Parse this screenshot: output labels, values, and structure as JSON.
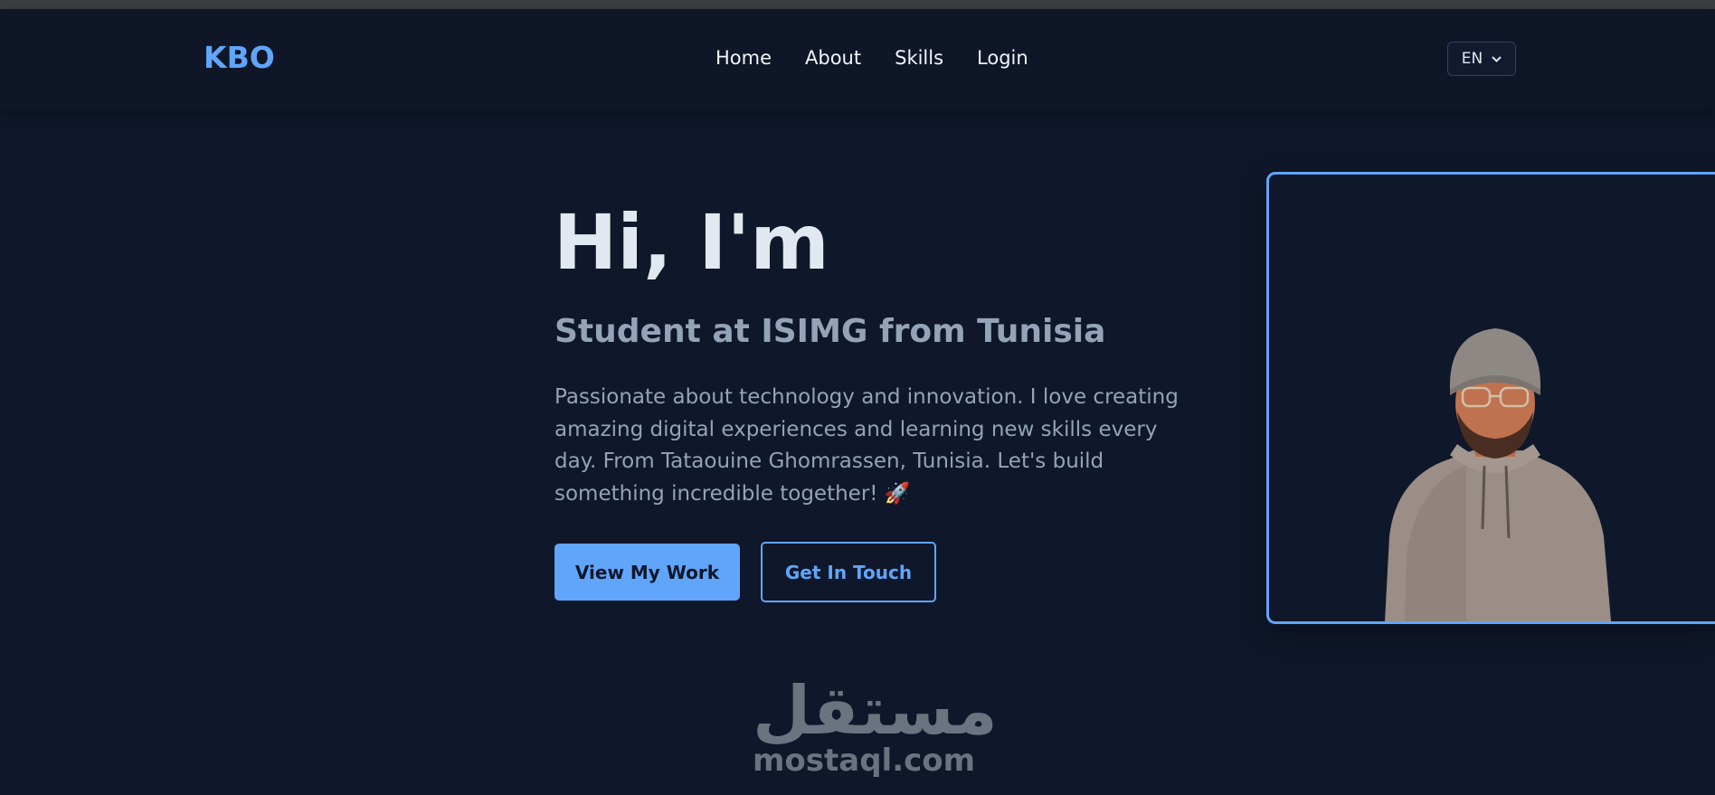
{
  "brand": {
    "logo": "KBO"
  },
  "nav": {
    "items": [
      "Home",
      "About",
      "Skills",
      "Login"
    ]
  },
  "language": {
    "selected": "EN"
  },
  "hero": {
    "greeting": "Hi, I'm",
    "subtitle": "Student at ISIMG from Tunisia",
    "description": "Passionate about technology and innovation. I love creating amazing digital experiences and learning new skills every day. From Tataouine Ghomrassen, Tunisia. Let's build something incredible together! 🚀",
    "primary_button": "View My Work",
    "secondary_button": "Get In Touch"
  },
  "watermark": {
    "arabic": "مستقل",
    "latin": "mostaql.com"
  },
  "colors": {
    "background": "#0f172a",
    "accent": "#60a5fa",
    "muted": "#94a3b8"
  }
}
